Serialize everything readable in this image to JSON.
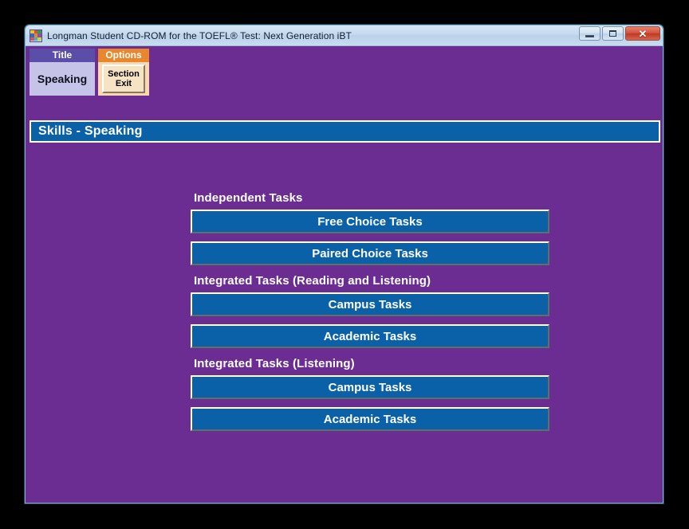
{
  "window": {
    "title": "Longman Student CD-ROM for the TOEFL® Test: Next Generation iBT",
    "icon": "longman-logo-icon",
    "controls": {
      "minimize_label": "Minimize",
      "maximize_label": "Maximize",
      "close_label": "Close",
      "close_glyph": "✕"
    },
    "icon_colors": [
      "#f2c232",
      "#d94f3d",
      "#2f9e4f",
      "#2f6fb5",
      "#e8862b",
      "#8e4fa8",
      "#d94f7a",
      "#3fb5c4",
      "#c4d93f"
    ]
  },
  "panels": {
    "title_panel": {
      "header": "Title",
      "value": "Speaking"
    },
    "options_panel": {
      "header": "Options",
      "button_line1": "Section",
      "button_line2": "Exit"
    }
  },
  "skills_header": {
    "text": "Skills - Speaking"
  },
  "task_groups": [
    {
      "label": "Independent Tasks",
      "buttons": [
        "Free Choice Tasks",
        "Paired Choice Tasks"
      ]
    },
    {
      "label": "Integrated Tasks (Reading and Listening)",
      "buttons": [
        "Campus Tasks",
        "Academic Tasks"
      ]
    },
    {
      "label": "Integrated Tasks (Listening)",
      "buttons": [
        "Campus Tasks",
        "Academic Tasks"
      ]
    }
  ],
  "colors": {
    "background_purple": "#6b2d91",
    "button_blue": "#0a61a8",
    "title_panel_header": "#5b4ea8",
    "title_panel_body": "#c5c3e8",
    "options_header_orange": "#e8872b",
    "options_body": "#fbd9b0",
    "exit_button_face": "#f6e3c4",
    "desktop": "#000000"
  }
}
